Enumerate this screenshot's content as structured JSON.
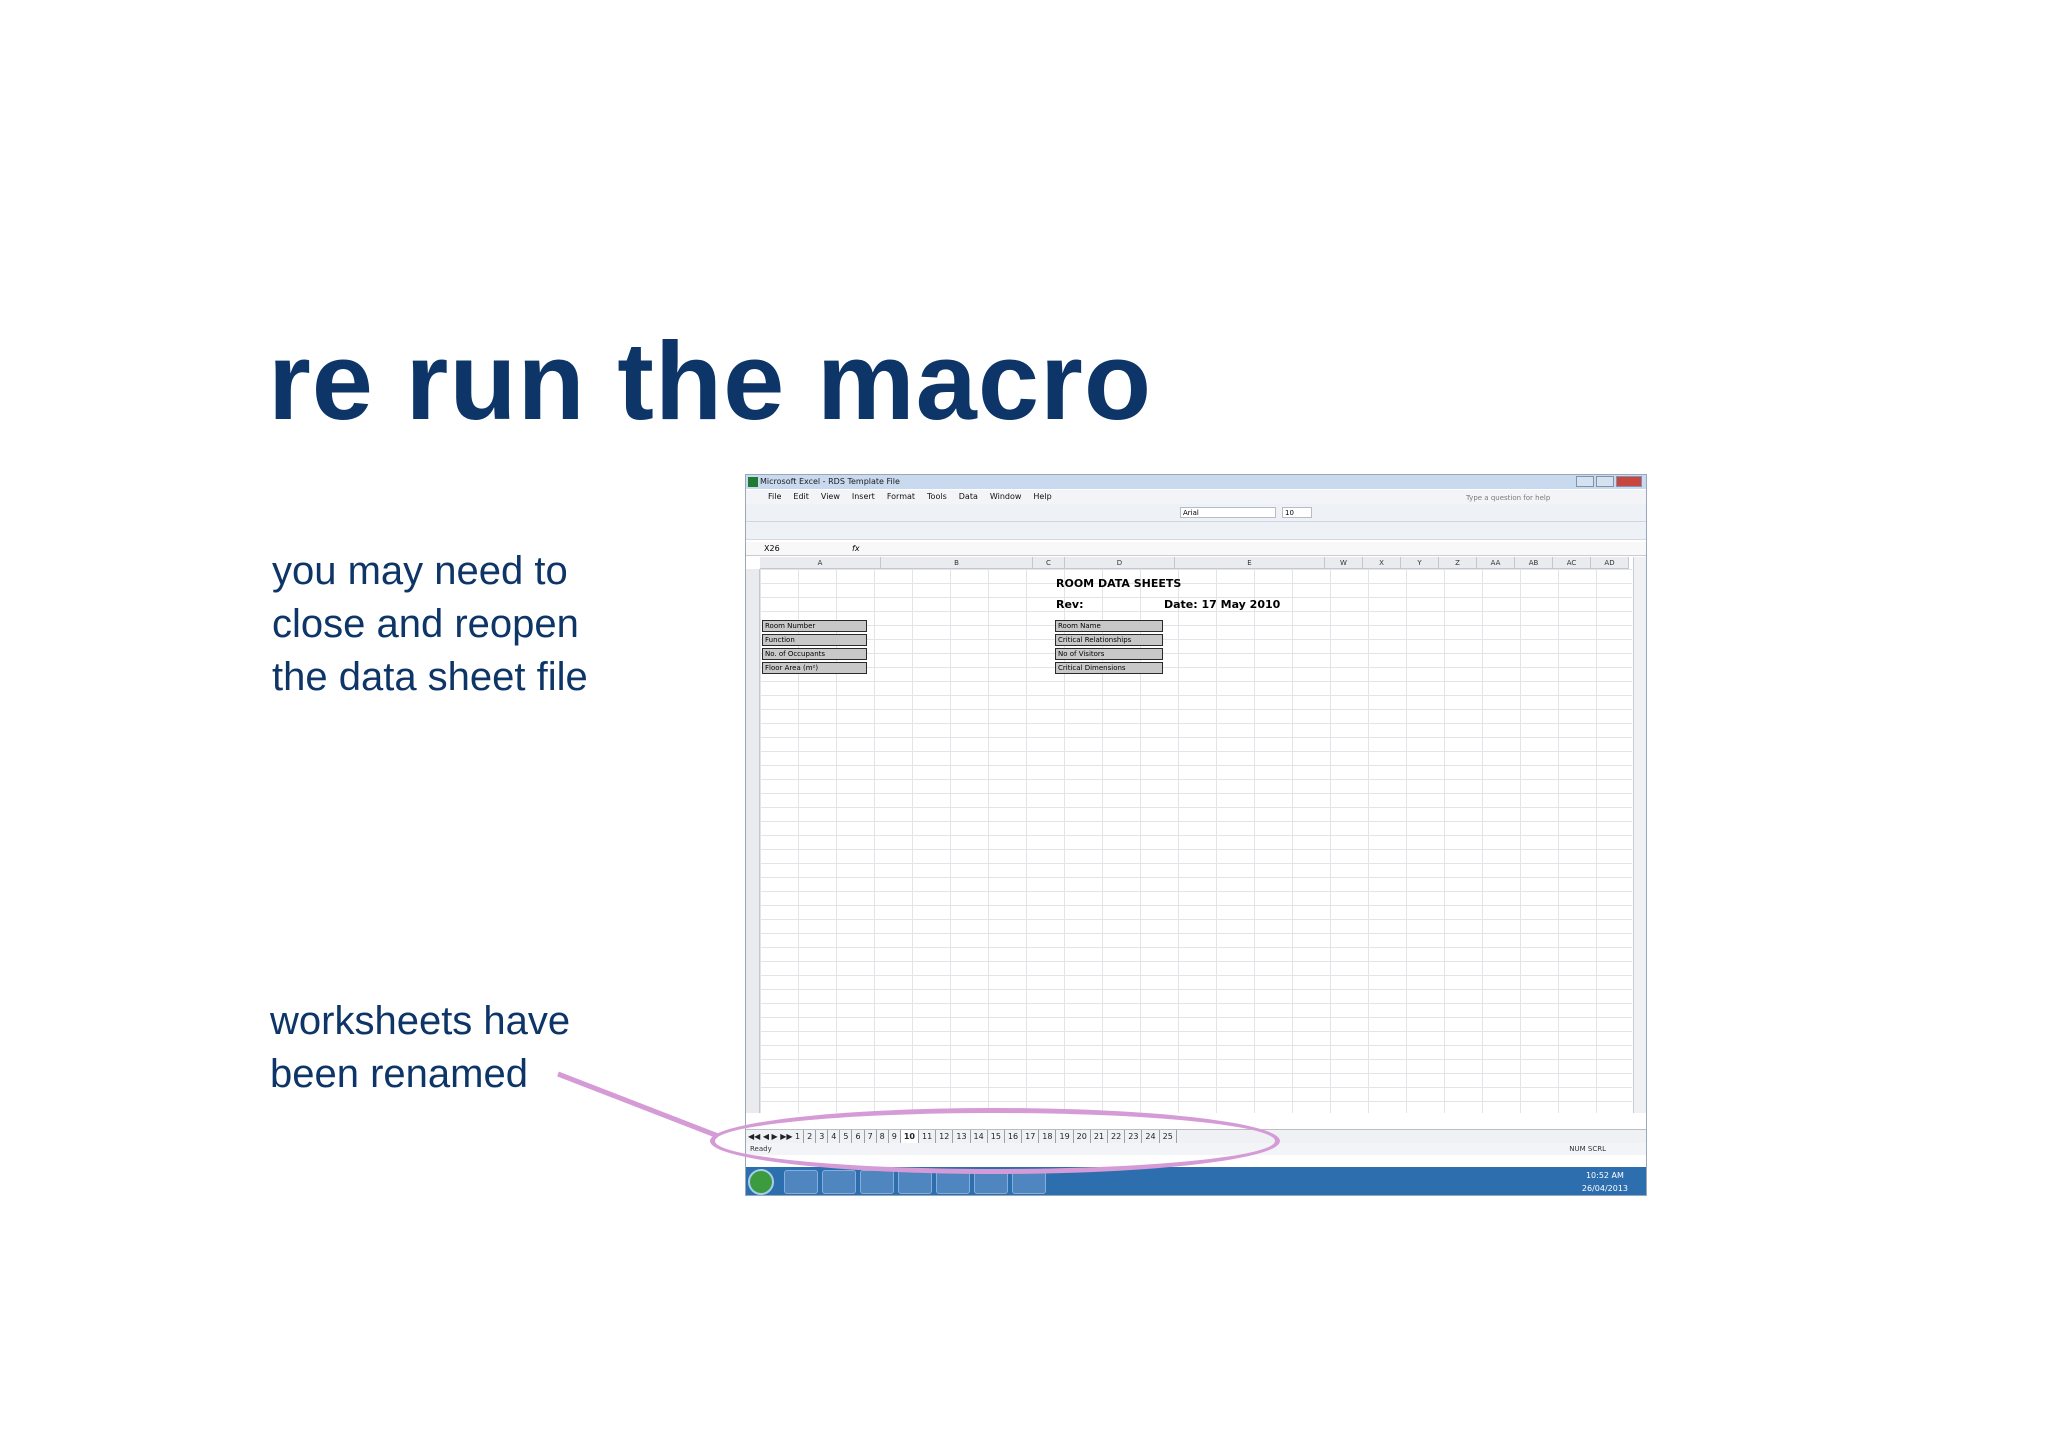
{
  "slide": {
    "title": "re run the macro",
    "caption_top": [
      "you may need to",
      "close and reopen",
      "the data sheet file"
    ],
    "caption_bottom": [
      "worksheets have",
      "been renamed"
    ]
  },
  "excel": {
    "window_title": "Microsoft Excel - RDS Template File",
    "menu": [
      "File",
      "Edit",
      "View",
      "Insert",
      "Format",
      "Tools",
      "Data",
      "Window",
      "Help"
    ],
    "help_box": "Type a question for help",
    "font_name": "Arial",
    "font_size": "10",
    "name_box": "X26",
    "fx": "fx",
    "columns": [
      "A",
      "B",
      "C",
      "D",
      "E",
      "W",
      "X",
      "Y",
      "Z",
      "AA",
      "AB",
      "AC",
      "AD"
    ],
    "sheet": {
      "heading": "ROOM DATA SHEETS",
      "rev_label": "Rev:",
      "date_label": "Date: 17 May 2010",
      "left_rows": [
        "Room Number",
        "Function",
        "No. of Occupants",
        "Floor Area (m²)"
      ],
      "right_rows": [
        "Room Name",
        "Critical Relationships",
        "No of Visitors",
        "Critical Dimensions"
      ]
    },
    "tabs": [
      "1",
      "2",
      "3",
      "4",
      "5",
      "6",
      "7",
      "8",
      "9",
      "10",
      "11",
      "12",
      "13",
      "14",
      "15",
      "16",
      "17",
      "18",
      "19",
      "20",
      "21",
      "22",
      "23",
      "24",
      "25"
    ],
    "active_tab_index": 9,
    "status": {
      "left": "Ready",
      "right": "NUM SCRL"
    },
    "tray": {
      "time": "10:52 AM",
      "date": "26/04/2013"
    }
  },
  "colors": {
    "title_blue": "#0d3567",
    "highlight_purple": "#d49bd6"
  }
}
